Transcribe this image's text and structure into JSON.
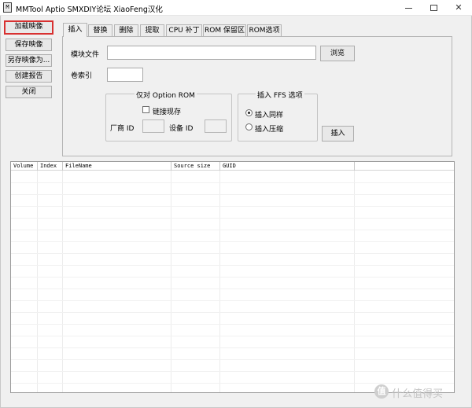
{
  "window": {
    "title": "MMTool Aptio SMXDIY论坛 XiaoFeng汉化",
    "icon_label": "M",
    "minimize_icon": "minimize-icon",
    "maximize_icon": "maximize-icon",
    "close_glyph": "✕"
  },
  "left_buttons": {
    "load_image": "加载映像",
    "save_image": "保存映像",
    "save_image_as": "另存映像为...",
    "create_report": "创建报告",
    "close": "关闭"
  },
  "tabs": [
    "插入",
    "替换",
    "删除",
    "提取",
    "CPU 补丁",
    "ROM 保留区",
    "ROM选项"
  ],
  "insert_tab": {
    "module_file_label": "模块文件",
    "module_file_value": "",
    "browse_button": "浏览",
    "volume_index_label": "卷索引",
    "volume_index_value": "",
    "option_rom_group": {
      "title": "仅对 Option ROM",
      "link_checkbox_label": "链接现存",
      "link_checked": false,
      "vendor_id_label": "厂商 ID",
      "device_id_label": "设备 ID",
      "vendor_id_value": "",
      "device_id_value": ""
    },
    "ffs_group": {
      "title": "插入 FFS 选项",
      "options": [
        "插入同样",
        "插入压缩"
      ],
      "selected": "插入同样"
    },
    "insert_button": "插入"
  },
  "list": {
    "columns": [
      "Volume",
      "Index",
      "FileName",
      "Source size",
      "GUID"
    ],
    "rows": []
  },
  "watermark": {
    "badge": "值",
    "text": "什么值得买"
  },
  "colors": {
    "highlight_border": "#d83030",
    "window_bg": "#f0f0f0"
  }
}
